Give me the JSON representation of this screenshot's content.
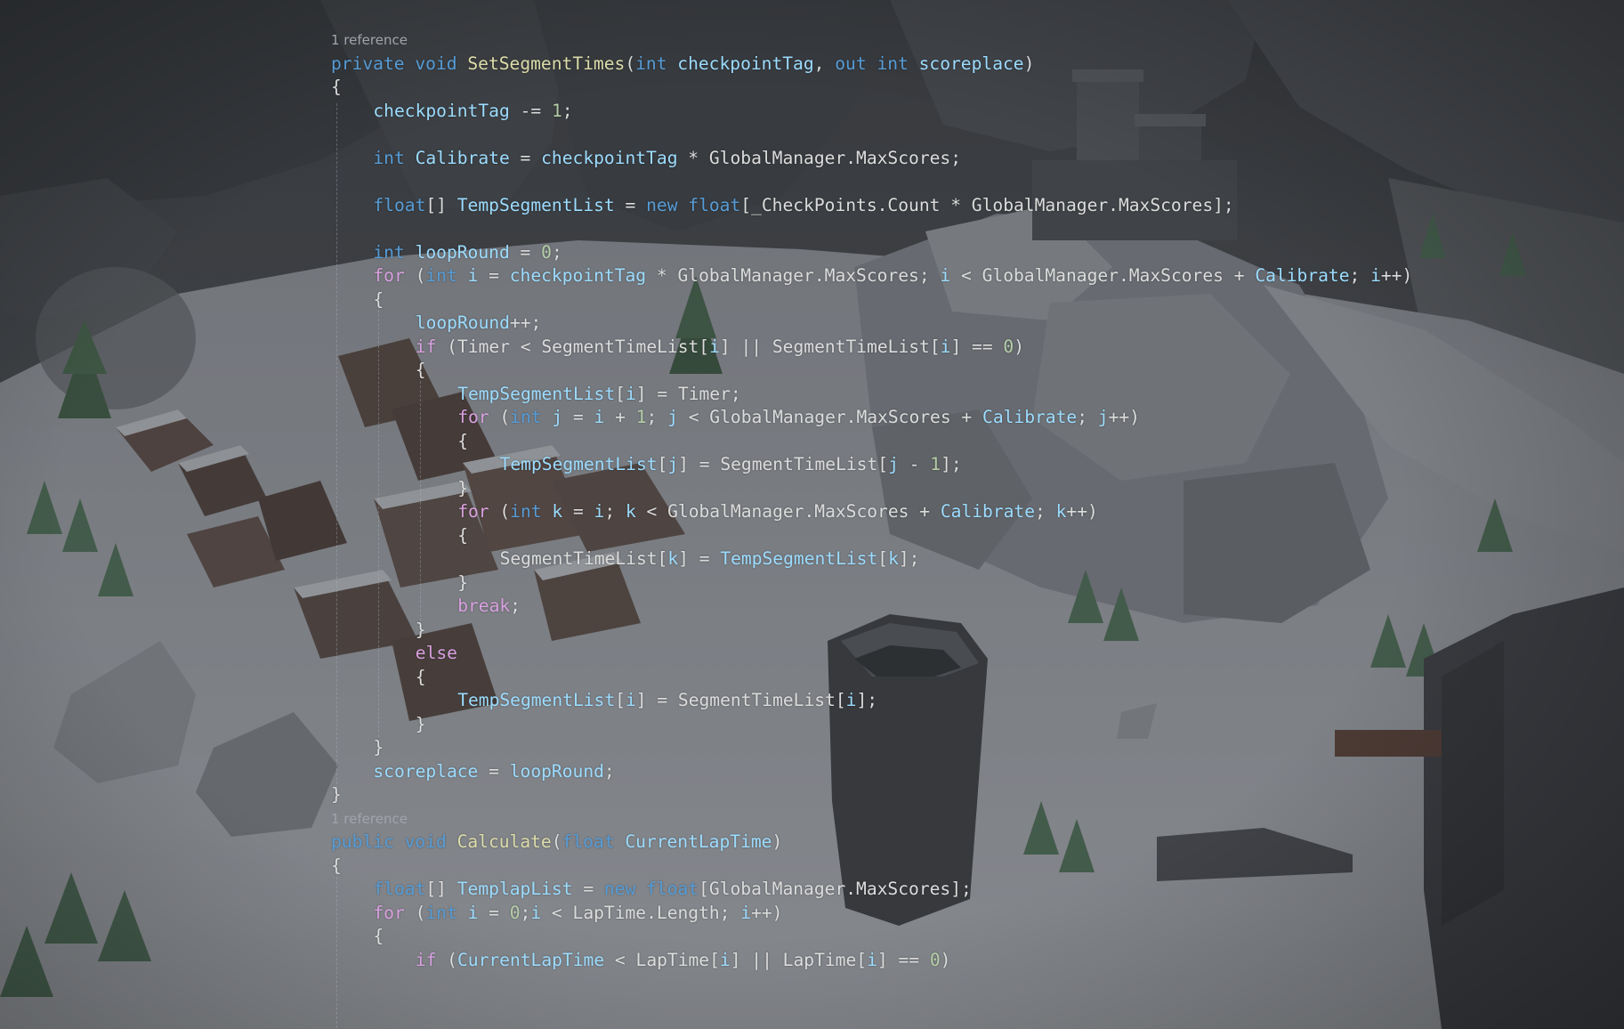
{
  "colors": {
    "keyword": "#569CD6",
    "control": "#D8A0DF",
    "type": "#4EC9B0",
    "method": "#DCDCAA",
    "param": "#9CDCFE",
    "number": "#B5CEA8",
    "plain": "#DCDCDC",
    "codelens": "#A0A4AA"
  },
  "code": {
    "lines": [
      {
        "kind": "lens",
        "indent": 0,
        "tokens": [
          {
            "t": "1 reference",
            "c": "codelens"
          }
        ]
      },
      {
        "indent": 0,
        "tokens": [
          {
            "t": "private",
            "c": "keyword"
          },
          {
            "t": " ",
            "c": "plain"
          },
          {
            "t": "void",
            "c": "keyword"
          },
          {
            "t": " ",
            "c": "plain"
          },
          {
            "t": "SetSegmentTimes",
            "c": "method"
          },
          {
            "t": "(",
            "c": "plain"
          },
          {
            "t": "int",
            "c": "keyword"
          },
          {
            "t": " ",
            "c": "plain"
          },
          {
            "t": "checkpointTag",
            "c": "param"
          },
          {
            "t": ", ",
            "c": "plain"
          },
          {
            "t": "out",
            "c": "keyword"
          },
          {
            "t": " ",
            "c": "plain"
          },
          {
            "t": "int",
            "c": "keyword"
          },
          {
            "t": " ",
            "c": "plain"
          },
          {
            "t": "scoreplace",
            "c": "param"
          },
          {
            "t": ")",
            "c": "plain"
          }
        ]
      },
      {
        "indent": 0,
        "tokens": [
          {
            "t": "{",
            "c": "plain"
          }
        ]
      },
      {
        "indent": 1,
        "tokens": [
          {
            "t": "checkpointTag",
            "c": "param"
          },
          {
            "t": " -= ",
            "c": "plain"
          },
          {
            "t": "1",
            "c": "number"
          },
          {
            "t": ";",
            "c": "plain"
          }
        ]
      },
      {
        "indent": 0,
        "tokens": []
      },
      {
        "indent": 1,
        "tokens": [
          {
            "t": "int",
            "c": "keyword"
          },
          {
            "t": " ",
            "c": "plain"
          },
          {
            "t": "Calibrate",
            "c": "param"
          },
          {
            "t": " = ",
            "c": "plain"
          },
          {
            "t": "checkpointTag",
            "c": "param"
          },
          {
            "t": " * ",
            "c": "plain"
          },
          {
            "t": "GlobalManager",
            "c": "plain"
          },
          {
            "t": ".",
            "c": "plain"
          },
          {
            "t": "MaxScores",
            "c": "plain"
          },
          {
            "t": ";",
            "c": "plain"
          }
        ]
      },
      {
        "indent": 0,
        "tokens": []
      },
      {
        "indent": 1,
        "tokens": [
          {
            "t": "float",
            "c": "keyword"
          },
          {
            "t": "[] ",
            "c": "plain"
          },
          {
            "t": "TempSegmentList",
            "c": "param"
          },
          {
            "t": " = ",
            "c": "plain"
          },
          {
            "t": "new",
            "c": "keyword"
          },
          {
            "t": " ",
            "c": "plain"
          },
          {
            "t": "float",
            "c": "keyword"
          },
          {
            "t": "[_CheckPoints.Count * GlobalManager.MaxScores];",
            "c": "plain"
          }
        ]
      },
      {
        "indent": 0,
        "tokens": []
      },
      {
        "indent": 1,
        "tokens": [
          {
            "t": "int",
            "c": "keyword"
          },
          {
            "t": " ",
            "c": "plain"
          },
          {
            "t": "loopRound",
            "c": "param"
          },
          {
            "t": " = ",
            "c": "plain"
          },
          {
            "t": "0",
            "c": "number"
          },
          {
            "t": ";",
            "c": "plain"
          }
        ]
      },
      {
        "indent": 1,
        "tokens": [
          {
            "t": "for",
            "c": "control"
          },
          {
            "t": " (",
            "c": "plain"
          },
          {
            "t": "int",
            "c": "keyword"
          },
          {
            "t": " ",
            "c": "plain"
          },
          {
            "t": "i",
            "c": "param"
          },
          {
            "t": " = ",
            "c": "plain"
          },
          {
            "t": "checkpointTag",
            "c": "param"
          },
          {
            "t": " * GlobalManager.MaxScores; ",
            "c": "plain"
          },
          {
            "t": "i",
            "c": "param"
          },
          {
            "t": " < GlobalManager.MaxScores + ",
            "c": "plain"
          },
          {
            "t": "Calibrate",
            "c": "param"
          },
          {
            "t": "; ",
            "c": "plain"
          },
          {
            "t": "i",
            "c": "param"
          },
          {
            "t": "++)",
            "c": "plain"
          }
        ]
      },
      {
        "indent": 1,
        "tokens": [
          {
            "t": "{",
            "c": "plain"
          }
        ]
      },
      {
        "indent": 2,
        "tokens": [
          {
            "t": "loopRound",
            "c": "param"
          },
          {
            "t": "++;",
            "c": "plain"
          }
        ]
      },
      {
        "indent": 2,
        "tokens": [
          {
            "t": "if",
            "c": "control"
          },
          {
            "t": " (Timer < SegmentTimeList[",
            "c": "plain"
          },
          {
            "t": "i",
            "c": "param"
          },
          {
            "t": "] || SegmentTimeList[",
            "c": "plain"
          },
          {
            "t": "i",
            "c": "param"
          },
          {
            "t": "] == ",
            "c": "plain"
          },
          {
            "t": "0",
            "c": "number"
          },
          {
            "t": ")",
            "c": "plain"
          }
        ]
      },
      {
        "indent": 2,
        "tokens": [
          {
            "t": "{",
            "c": "plain"
          }
        ]
      },
      {
        "indent": 3,
        "tokens": [
          {
            "t": "TempSegmentList",
            "c": "param"
          },
          {
            "t": "[",
            "c": "plain"
          },
          {
            "t": "i",
            "c": "param"
          },
          {
            "t": "] = Timer;",
            "c": "plain"
          }
        ]
      },
      {
        "indent": 3,
        "tokens": [
          {
            "t": "for",
            "c": "control"
          },
          {
            "t": " (",
            "c": "plain"
          },
          {
            "t": "int",
            "c": "keyword"
          },
          {
            "t": " ",
            "c": "plain"
          },
          {
            "t": "j",
            "c": "param"
          },
          {
            "t": " = ",
            "c": "plain"
          },
          {
            "t": "i",
            "c": "param"
          },
          {
            "t": " + ",
            "c": "plain"
          },
          {
            "t": "1",
            "c": "number"
          },
          {
            "t": "; ",
            "c": "plain"
          },
          {
            "t": "j",
            "c": "param"
          },
          {
            "t": " < GlobalManager.MaxScores + ",
            "c": "plain"
          },
          {
            "t": "Calibrate",
            "c": "param"
          },
          {
            "t": "; ",
            "c": "plain"
          },
          {
            "t": "j",
            "c": "param"
          },
          {
            "t": "++)",
            "c": "plain"
          }
        ]
      },
      {
        "indent": 3,
        "tokens": [
          {
            "t": "{",
            "c": "plain"
          }
        ]
      },
      {
        "indent": 4,
        "tokens": [
          {
            "t": "TempSegmentList",
            "c": "param"
          },
          {
            "t": "[",
            "c": "plain"
          },
          {
            "t": "j",
            "c": "param"
          },
          {
            "t": "] = SegmentTimeList[",
            "c": "plain"
          },
          {
            "t": "j",
            "c": "param"
          },
          {
            "t": " - ",
            "c": "plain"
          },
          {
            "t": "1",
            "c": "number"
          },
          {
            "t": "];",
            "c": "plain"
          }
        ]
      },
      {
        "indent": 3,
        "tokens": [
          {
            "t": "}",
            "c": "plain"
          }
        ]
      },
      {
        "indent": 3,
        "tokens": [
          {
            "t": "for",
            "c": "control"
          },
          {
            "t": " (",
            "c": "plain"
          },
          {
            "t": "int",
            "c": "keyword"
          },
          {
            "t": " ",
            "c": "plain"
          },
          {
            "t": "k",
            "c": "param"
          },
          {
            "t": " = ",
            "c": "plain"
          },
          {
            "t": "i",
            "c": "param"
          },
          {
            "t": "; ",
            "c": "plain"
          },
          {
            "t": "k",
            "c": "param"
          },
          {
            "t": " < GlobalManager.MaxScores + ",
            "c": "plain"
          },
          {
            "t": "Calibrate",
            "c": "param"
          },
          {
            "t": "; ",
            "c": "plain"
          },
          {
            "t": "k",
            "c": "param"
          },
          {
            "t": "++)",
            "c": "plain"
          }
        ]
      },
      {
        "indent": 3,
        "tokens": [
          {
            "t": "{",
            "c": "plain"
          }
        ]
      },
      {
        "indent": 4,
        "tokens": [
          {
            "t": "SegmentTimeList[",
            "c": "plain"
          },
          {
            "t": "k",
            "c": "param"
          },
          {
            "t": "] = ",
            "c": "plain"
          },
          {
            "t": "TempSegmentList",
            "c": "param"
          },
          {
            "t": "[",
            "c": "plain"
          },
          {
            "t": "k",
            "c": "param"
          },
          {
            "t": "];",
            "c": "plain"
          }
        ]
      },
      {
        "indent": 3,
        "tokens": [
          {
            "t": "}",
            "c": "plain"
          }
        ]
      },
      {
        "indent": 3,
        "tokens": [
          {
            "t": "break",
            "c": "control"
          },
          {
            "t": ";",
            "c": "plain"
          }
        ]
      },
      {
        "indent": 2,
        "tokens": [
          {
            "t": "}",
            "c": "plain"
          }
        ]
      },
      {
        "indent": 2,
        "tokens": [
          {
            "t": "else",
            "c": "control"
          }
        ]
      },
      {
        "indent": 2,
        "tokens": [
          {
            "t": "{",
            "c": "plain"
          }
        ]
      },
      {
        "indent": 3,
        "tokens": [
          {
            "t": "TempSegmentList",
            "c": "param"
          },
          {
            "t": "[",
            "c": "plain"
          },
          {
            "t": "i",
            "c": "param"
          },
          {
            "t": "] = SegmentTimeList[",
            "c": "plain"
          },
          {
            "t": "i",
            "c": "param"
          },
          {
            "t": "];",
            "c": "plain"
          }
        ]
      },
      {
        "indent": 2,
        "tokens": [
          {
            "t": "}",
            "c": "plain"
          }
        ]
      },
      {
        "indent": 1,
        "tokens": [
          {
            "t": "}",
            "c": "plain"
          }
        ]
      },
      {
        "indent": 1,
        "tokens": [
          {
            "t": "scoreplace",
            "c": "param"
          },
          {
            "t": " = ",
            "c": "plain"
          },
          {
            "t": "loopRound",
            "c": "param"
          },
          {
            "t": ";",
            "c": "plain"
          }
        ]
      },
      {
        "indent": 0,
        "tokens": [
          {
            "t": "}",
            "c": "plain"
          }
        ]
      },
      {
        "kind": "lens",
        "indent": 0,
        "tokens": [
          {
            "t": "1 reference",
            "c": "codelens"
          }
        ]
      },
      {
        "indent": 0,
        "tokens": [
          {
            "t": "public",
            "c": "keyword"
          },
          {
            "t": " ",
            "c": "plain"
          },
          {
            "t": "void",
            "c": "keyword"
          },
          {
            "t": " ",
            "c": "plain"
          },
          {
            "t": "Calculate",
            "c": "method"
          },
          {
            "t": "(",
            "c": "plain"
          },
          {
            "t": "float",
            "c": "keyword"
          },
          {
            "t": " ",
            "c": "plain"
          },
          {
            "t": "CurrentLapTime",
            "c": "param"
          },
          {
            "t": ")",
            "c": "plain"
          }
        ]
      },
      {
        "indent": 0,
        "tokens": [
          {
            "t": "{",
            "c": "plain"
          }
        ]
      },
      {
        "indent": 1,
        "tokens": [
          {
            "t": "float",
            "c": "keyword"
          },
          {
            "t": "[] ",
            "c": "plain"
          },
          {
            "t": "TemplapList",
            "c": "param"
          },
          {
            "t": " = ",
            "c": "plain"
          },
          {
            "t": "new",
            "c": "keyword"
          },
          {
            "t": " ",
            "c": "plain"
          },
          {
            "t": "float",
            "c": "keyword"
          },
          {
            "t": "[GlobalManager.MaxScores];",
            "c": "plain"
          }
        ]
      },
      {
        "indent": 1,
        "tokens": [
          {
            "t": "for",
            "c": "control"
          },
          {
            "t": " (",
            "c": "plain"
          },
          {
            "t": "int",
            "c": "keyword"
          },
          {
            "t": " ",
            "c": "plain"
          },
          {
            "t": "i",
            "c": "param"
          },
          {
            "t": " = ",
            "c": "plain"
          },
          {
            "t": "0",
            "c": "number"
          },
          {
            "t": ";",
            "c": "plain"
          },
          {
            "t": "i",
            "c": "param"
          },
          {
            "t": " < LapTime.Length; ",
            "c": "plain"
          },
          {
            "t": "i",
            "c": "param"
          },
          {
            "t": "++)",
            "c": "plain"
          }
        ]
      },
      {
        "indent": 1,
        "tokens": [
          {
            "t": "{",
            "c": "plain"
          }
        ]
      },
      {
        "indent": 2,
        "tokens": [
          {
            "t": "if",
            "c": "control"
          },
          {
            "t": " (",
            "c": "plain"
          },
          {
            "t": "CurrentLapTime",
            "c": "param"
          },
          {
            "t": " < LapTime[",
            "c": "plain"
          },
          {
            "t": "i",
            "c": "param"
          },
          {
            "t": "] || LapTime[",
            "c": "plain"
          },
          {
            "t": "i",
            "c": "param"
          },
          {
            "t": "] == ",
            "c": "plain"
          },
          {
            "t": "0",
            "c": "number"
          },
          {
            "t": ")",
            "c": "plain"
          }
        ]
      }
    ]
  }
}
